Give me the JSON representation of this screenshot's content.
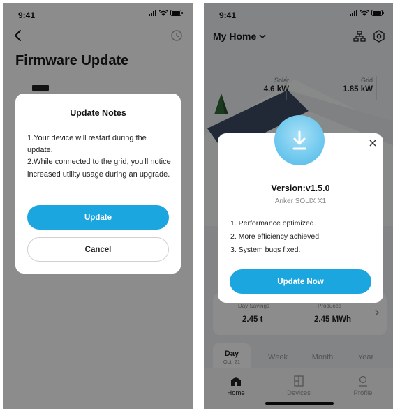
{
  "left": {
    "status": {
      "time": "9:41"
    },
    "page_title": "Firmware Update",
    "dialog": {
      "title": "Update Notes",
      "line1": "1.Your device will restart during the update.",
      "line2": "2.While connected to the grid, you'll notice increased utility usage during an upgrade.",
      "primary_label": "Update",
      "secondary_label": "Cancel"
    },
    "icons": {
      "back": "chevron-left-icon",
      "history": "history-icon"
    }
  },
  "right": {
    "status": {
      "time": "9:41"
    },
    "home_title": "My Home",
    "stats": {
      "solar": {
        "label": "Solar",
        "value": "4.6 kW"
      },
      "grid": {
        "label": "Grid",
        "value": "1.85 kW"
      }
    },
    "savings": {
      "left_label": "Day Savings",
      "left_value": "2.45 t",
      "right_label": "Produced",
      "right_value": "2.45 MWh"
    },
    "period_tabs": [
      {
        "label": "Day",
        "sub": "Oct. 21"
      },
      {
        "label": "Week"
      },
      {
        "label": "Month"
      },
      {
        "label": "Year"
      }
    ],
    "tabbar": [
      {
        "label": "Home",
        "icon": "home-icon"
      },
      {
        "label": "Devices",
        "icon": "devices-icon"
      },
      {
        "label": "Profile",
        "icon": "profile-icon"
      }
    ],
    "dialog": {
      "version": "Version:v1.5.0",
      "model": "Anker SOLIX X1",
      "notes": [
        "1. Performance optimized.",
        "2. More efficiency achieved.",
        "3. System bugs fixed."
      ],
      "button_label": "Update Now"
    }
  },
  "colors": {
    "accent": "#1ba6df",
    "overlay": "rgba(0,0,0,0.45)"
  }
}
